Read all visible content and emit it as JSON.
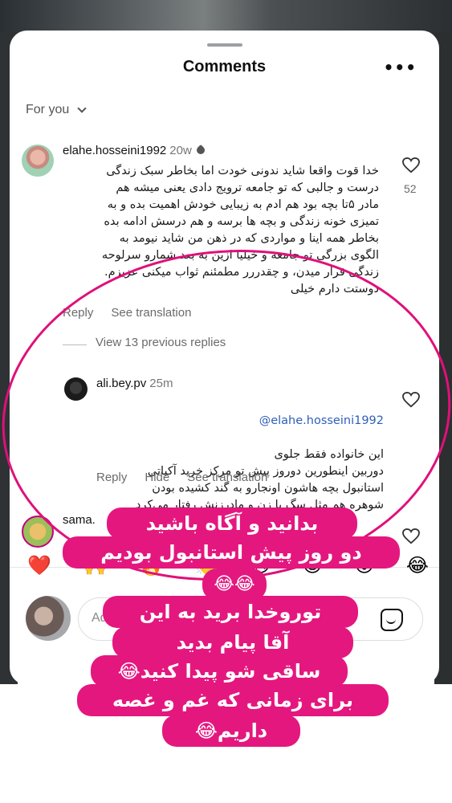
{
  "sheet": {
    "title": "Comments",
    "more_label": "•••",
    "sort_label": "For you"
  },
  "comments": [
    {
      "username": "elahe.hosseini1992",
      "time": "20w",
      "text": "خدا قوت واقعا شاید ندونی خودت اما بخاطر سبک زندگی\nدرست و جالبی که تو جامعه ترویج دادی یعنی میشه هم\nمادر ۵تا بچه بود هم ادم به زیبایی خودش اهمیت بده و به\nتمیزی خونه زندگی و بچه ها برسه و هم درسش ادامه بده\nبخاطر همه اینا و مواردی که در ذهن من شاید نیومد به\nالگوی بزرگی تو جامعه و خیلیا ازین به بعد شمارو سرلوحه\nزندگی قرار میدن، و چقدررر مطمئنم ثواب میکنی عزیزم.\nدوستت دارم خیلی",
      "likes": "52",
      "actions": [
        "Reply",
        "See translation"
      ]
    },
    {
      "username": "ali.bey.pv",
      "time": "25m",
      "mention": "@elahe.hosseini1992",
      "text": "این خانواده فقط جلوی\nدوربین اینطورین دوروز پیش تو مرکز خرید آکباتی\nاستانبول بچه هاشون اونجارو به گند کشیده بودن\nشوهره هم مثل سگ با زن و مادرزنش رفتار می‌کرد",
      "actions": [
        "Reply",
        "Hide",
        "See translation"
      ]
    },
    {
      "username": "sama."
    }
  ],
  "view_replies_label": "View 13 previous replies",
  "quick_emojis": [
    "❤️",
    "🙌",
    "🔥",
    "👏",
    "😢",
    "😍",
    "😮",
    "😂"
  ],
  "composer": {
    "placeholder": "Ad"
  },
  "story_text": [
    "بدانید و آگاه باشید",
    "دو روز پیش استانبول بودیم",
    "😂😂",
    "توروخدا برید به این",
    "آقا پیام بدید",
    "ساقی شو پیدا کنید😂",
    "برای زمانی که غم و غصه",
    "داریم😂"
  ],
  "colors": {
    "accent": "#e4177f",
    "mention": "#2f5fb8"
  }
}
